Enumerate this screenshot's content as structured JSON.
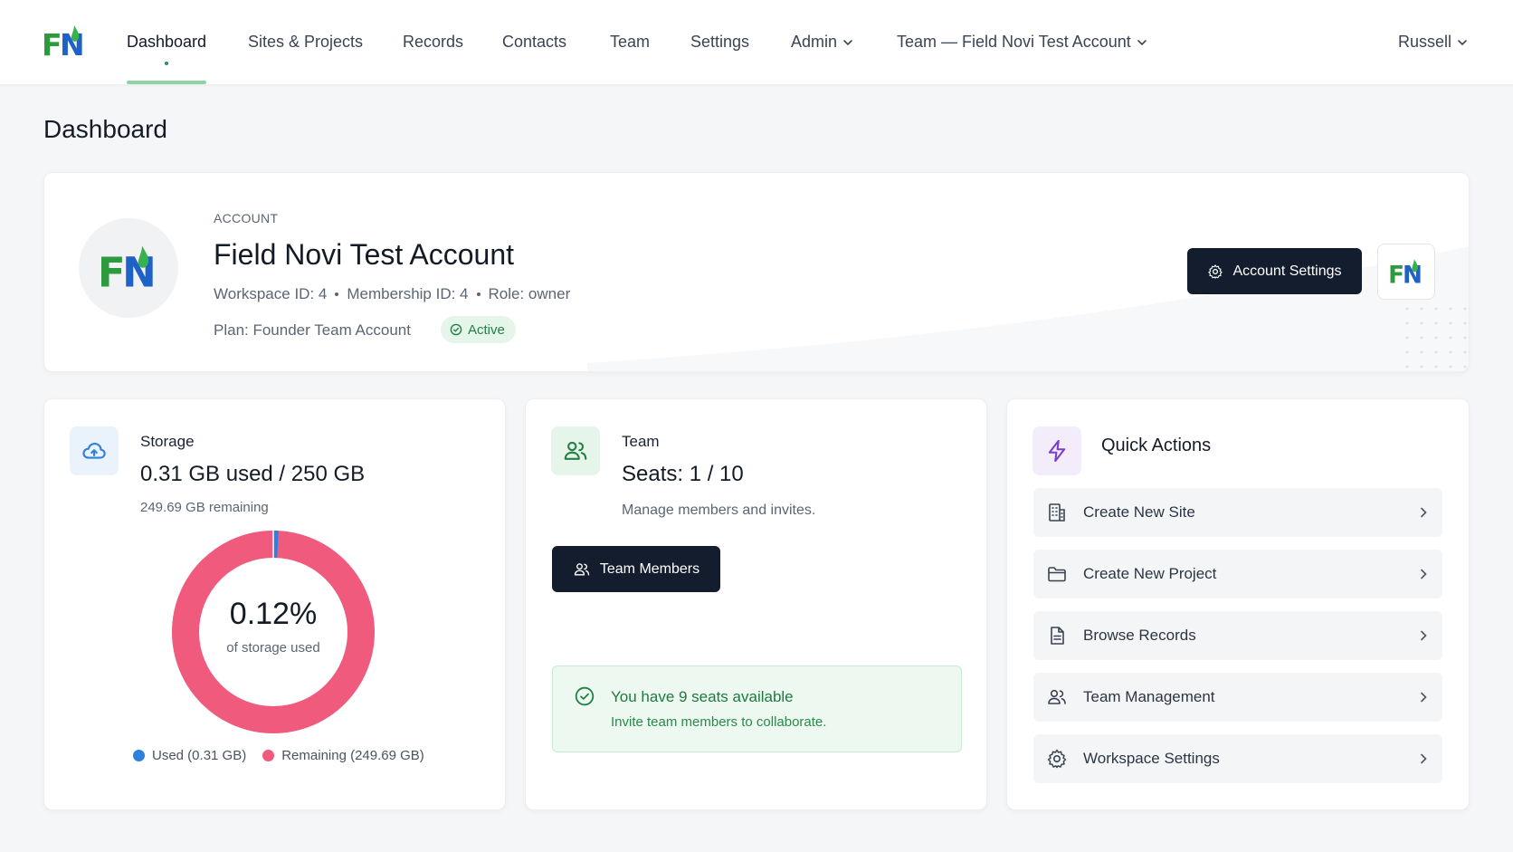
{
  "app": {
    "logo_text": "FN"
  },
  "nav": {
    "items": [
      {
        "label": "Dashboard",
        "active": true
      },
      {
        "label": "Sites & Projects"
      },
      {
        "label": "Records"
      },
      {
        "label": "Contacts"
      },
      {
        "label": "Team"
      },
      {
        "label": "Settings"
      },
      {
        "label": "Admin",
        "dropdown": true
      },
      {
        "label": "Team — Field Novi Test Account",
        "dropdown": true
      }
    ],
    "user": "Russell"
  },
  "page": {
    "title": "Dashboard"
  },
  "account": {
    "eyebrow": "ACCOUNT",
    "name": "Field Novi Test Account",
    "workspace": "Workspace ID: 4",
    "membership": "Membership ID: 4",
    "role": "Role: owner",
    "plan": "Plan: Founder Team Account",
    "status": "Active",
    "settings_label": "Account Settings"
  },
  "storage": {
    "label": "Storage",
    "value": "0.31 GB used / 250 GB",
    "remaining": "249.69 GB remaining",
    "percent_text": "0.12%",
    "percent_sub": "of storage used",
    "used_fraction": 0.0012,
    "legend_used": "Used (0.31 GB)",
    "legend_remaining": "Remaining (249.69 GB)",
    "colors": {
      "used": "#2f7fdc",
      "remaining": "#f05a7c"
    }
  },
  "team": {
    "label": "Team",
    "value": "Seats: 1 / 10",
    "description": "Manage members and invites.",
    "button_label": "Team Members",
    "seats_title": "You have 9 seats available",
    "seats_sub": "Invite team members to collaborate."
  },
  "quick_actions": {
    "title": "Quick Actions",
    "items": [
      {
        "label": "Create New Site",
        "icon": "building-icon"
      },
      {
        "label": "Create New Project",
        "icon": "folder-icon"
      },
      {
        "label": "Browse Records",
        "icon": "document-icon"
      },
      {
        "label": "Team Management",
        "icon": "users-icon"
      },
      {
        "label": "Workspace Settings",
        "icon": "gear-icon"
      }
    ]
  },
  "colors": {
    "brand_green": "#2e9a3e",
    "brand_blue": "#1e62c8",
    "dark_button": "#141d2e",
    "accent_underline": "#8fd3a3"
  }
}
